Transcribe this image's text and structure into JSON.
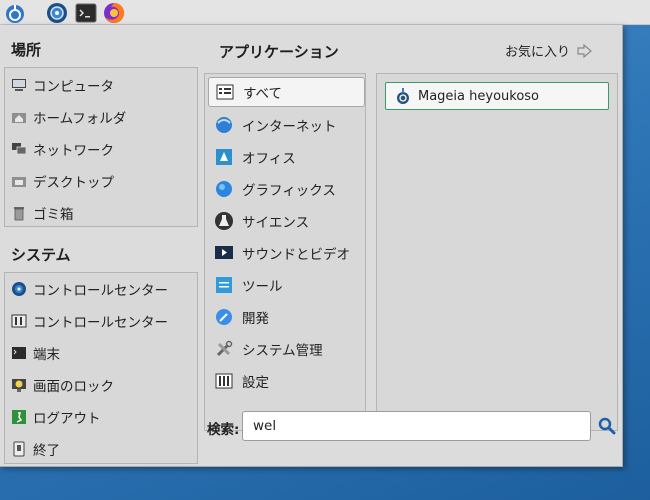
{
  "panel": {
    "icons": [
      "mageia-menu-icon",
      "control-center-icon",
      "terminal-icon",
      "firefox-icon"
    ]
  },
  "places": {
    "title": "場所",
    "items": [
      {
        "label": "コンピュータ",
        "icon": "computer-icon"
      },
      {
        "label": "ホームフォルダ",
        "icon": "home-folder-icon"
      },
      {
        "label": "ネットワーク",
        "icon": "network-icon"
      },
      {
        "label": "デスクトップ",
        "icon": "desktop-icon"
      },
      {
        "label": "ゴミ箱",
        "icon": "trash-icon"
      }
    ]
  },
  "system": {
    "title": "システム",
    "items": [
      {
        "label": "コントロールセンター",
        "icon": "control-center-icon"
      },
      {
        "label": "コントロールセンター",
        "icon": "settings-manager-icon"
      },
      {
        "label": "端末",
        "icon": "terminal-icon"
      },
      {
        "label": "画面のロック",
        "icon": "lock-screen-icon"
      },
      {
        "label": "ログアウト",
        "icon": "logout-icon"
      },
      {
        "label": "終了",
        "icon": "shutdown-icon"
      }
    ]
  },
  "applications": {
    "title": "アプリケーション",
    "favorites_label": "お気に入り",
    "categories": [
      {
        "label": "すべて",
        "icon": "all-apps-icon",
        "selected": true
      },
      {
        "label": "インターネット",
        "icon": "internet-icon"
      },
      {
        "label": "オフィス",
        "icon": "office-icon"
      },
      {
        "label": "グラフィックス",
        "icon": "graphics-icon"
      },
      {
        "label": "サイエンス",
        "icon": "science-icon"
      },
      {
        "label": "サウンドとビデオ",
        "icon": "multimedia-icon"
      },
      {
        "label": "ツール",
        "icon": "tools-icon"
      },
      {
        "label": "開発",
        "icon": "development-icon"
      },
      {
        "label": "システム管理",
        "icon": "system-admin-icon"
      },
      {
        "label": "設定",
        "icon": "settings-icon"
      }
    ],
    "results": [
      {
        "label": "Mageia heyoukoso",
        "icon": "mageia-icon"
      }
    ]
  },
  "search": {
    "label": "検索:",
    "value": "wel"
  },
  "colors": {
    "selection_border": "#3a9a6a",
    "desktop_background": "#2f77b8",
    "menu_background": "#dcdcdc"
  }
}
